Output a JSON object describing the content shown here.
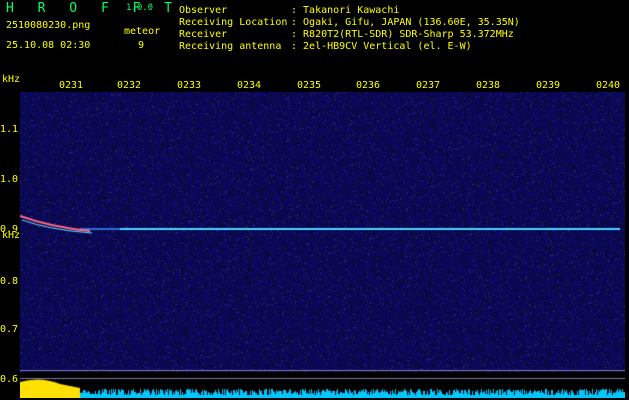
{
  "header": {
    "app_name": "H R O F F T",
    "version": "1.0.0",
    "filename": "2510080230.png",
    "datetime": "25.10.08 02:30",
    "meteor_label": "meteor",
    "meteor_count": "9",
    "observer_label": "Observer",
    "observer_value": ": Takanori Kawachi",
    "location_label": "Receiving Location",
    "location_value": ": Ogaki, Gifu, JAPAN (136.60E, 35.35N)",
    "receiver_label": "Receiver",
    "receiver_value": ": R820T2(RTL-SDR) SDR-Sharp 53.372MHz",
    "antenna_label": "Receiving antenna",
    "antenna_value": ": 2el-HB9CV Vertical (el. E-W)"
  },
  "axes": {
    "y_unit_top": "kHz",
    "y_unit_mid": "kHz",
    "x_ticks": [
      "0231",
      "0232",
      "0233",
      "0234",
      "0235",
      "0236",
      "0237",
      "0238",
      "0239",
      "0240"
    ],
    "y_ticks": [
      "1.1",
      "1.0",
      "0.9",
      "0.8",
      "0.7",
      "0.6"
    ]
  },
  "colors": {
    "background": "#000000",
    "noise": "#0a0a6e",
    "carrier": "#4fd4ff",
    "text": "#ffff00",
    "logo": "#00ff66"
  }
}
